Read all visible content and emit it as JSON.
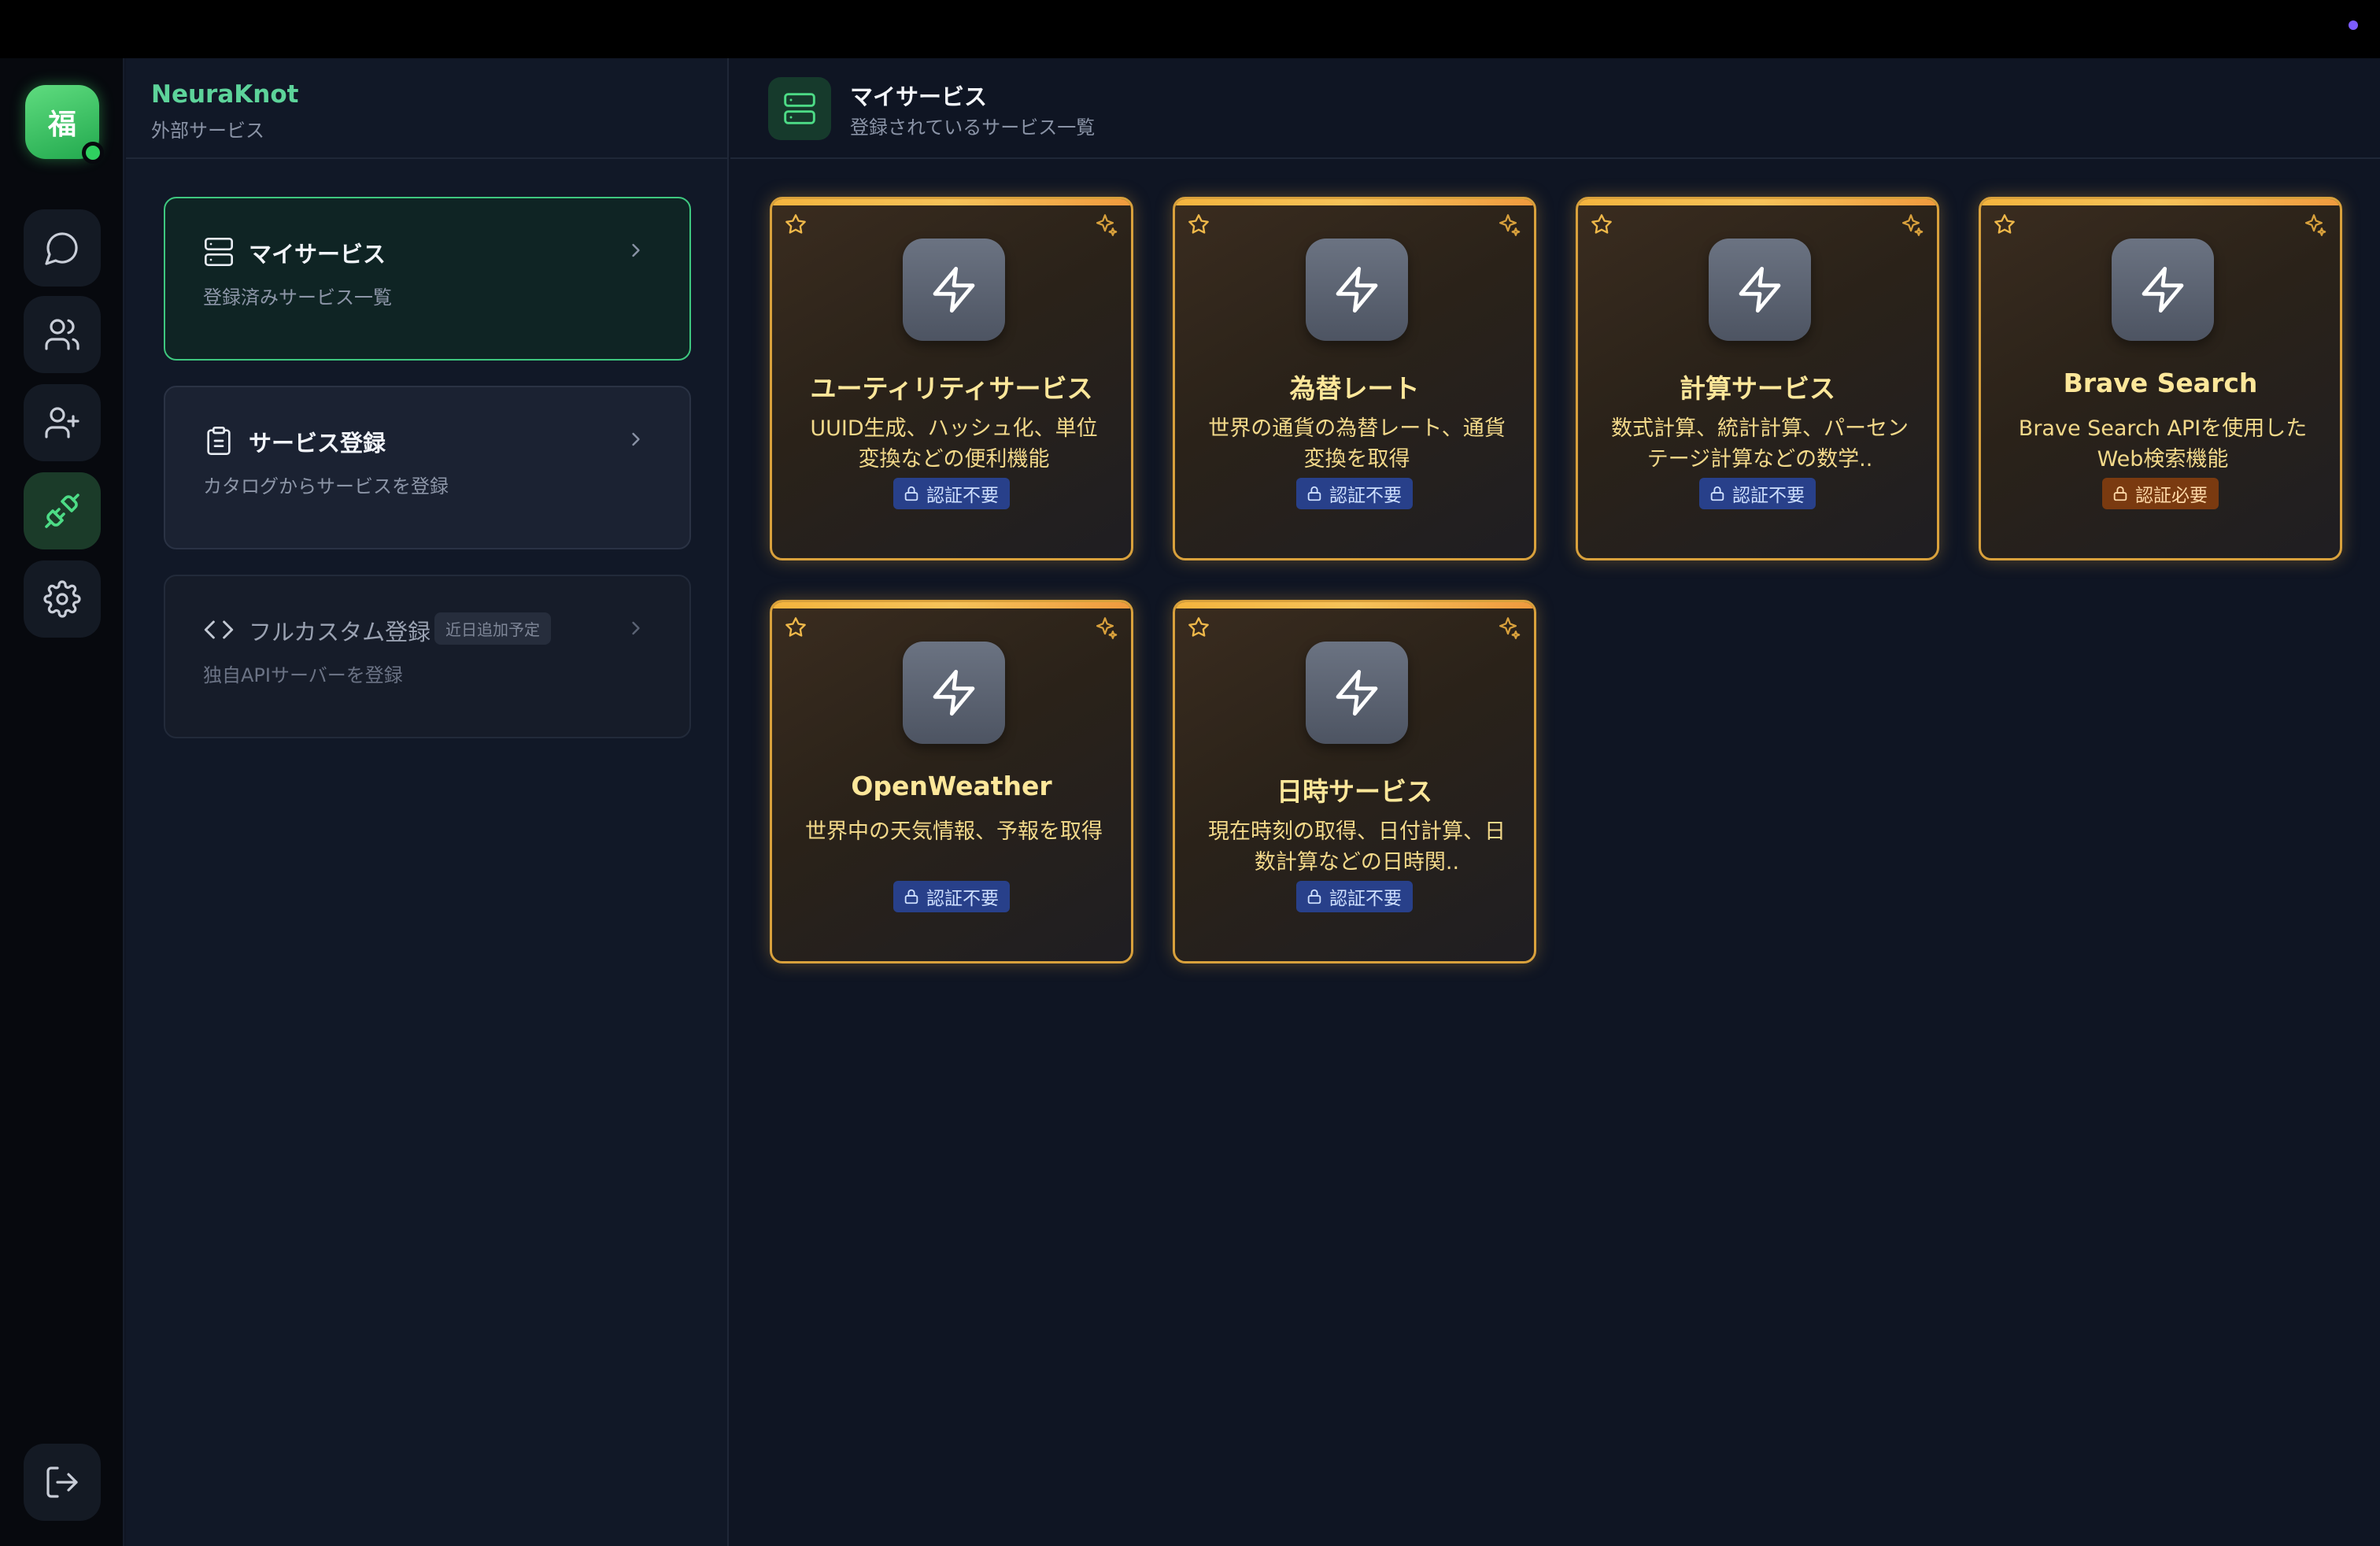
{
  "app": {
    "name": "NeuraKnot",
    "section": "外部サービス",
    "avatar_char": "福"
  },
  "colors": {
    "accent_green": "#3ec77f",
    "card_border": "#d9a13c",
    "status_dot": "#7c5cff"
  },
  "rail": {
    "items": [
      {
        "name": "chat",
        "icon": "chat-bubble-icon"
      },
      {
        "name": "users",
        "icon": "users-icon"
      },
      {
        "name": "add-user",
        "icon": "user-plus-icon"
      },
      {
        "name": "plugins",
        "icon": "plug-icon",
        "active": true
      },
      {
        "name": "settings",
        "icon": "gear-icon"
      }
    ],
    "logout_icon": "logout-icon"
  },
  "sidebar": {
    "menu": [
      {
        "title": "マイサービス",
        "subtitle": "登録済みサービス一覧",
        "icon": "server-icon",
        "active": true
      },
      {
        "title": "サービス登録",
        "subtitle": "カタログからサービスを登録",
        "icon": "clipboard-icon"
      },
      {
        "title": "フルカスタム登録",
        "subtitle": "独自APIサーバーを登録",
        "icon": "code-icon",
        "badge": "近日追加予定",
        "disabled": true
      }
    ]
  },
  "main": {
    "title": "マイサービス",
    "subtitle": "登録されているサービス一覧",
    "cards": [
      {
        "title": "ユーティリティサービス",
        "description": "UUID生成、ハッシュ化、単位変換などの便利機能",
        "auth": "認証不要",
        "auth_required": false
      },
      {
        "title": "為替レート",
        "description": "世界の通貨の為替レート、通貨変換を取得",
        "auth": "認証不要",
        "auth_required": false
      },
      {
        "title": "計算サービス",
        "description": "数式計算、統計計算、パーセンテージ計算などの数学..",
        "auth": "認証不要",
        "auth_required": false
      },
      {
        "title": "Brave Search",
        "description": "Brave Search APIを使用したWeb検索機能",
        "auth": "認証必要",
        "auth_required": true
      },
      {
        "title": "OpenWeather",
        "description": "世界中の天気情報、予報を取得",
        "auth": "認証不要",
        "auth_required": false
      },
      {
        "title": "日時サービス",
        "description": "現在時刻の取得、日付計算、日数計算などの日時関..",
        "auth": "認証不要",
        "auth_required": false
      }
    ]
  }
}
